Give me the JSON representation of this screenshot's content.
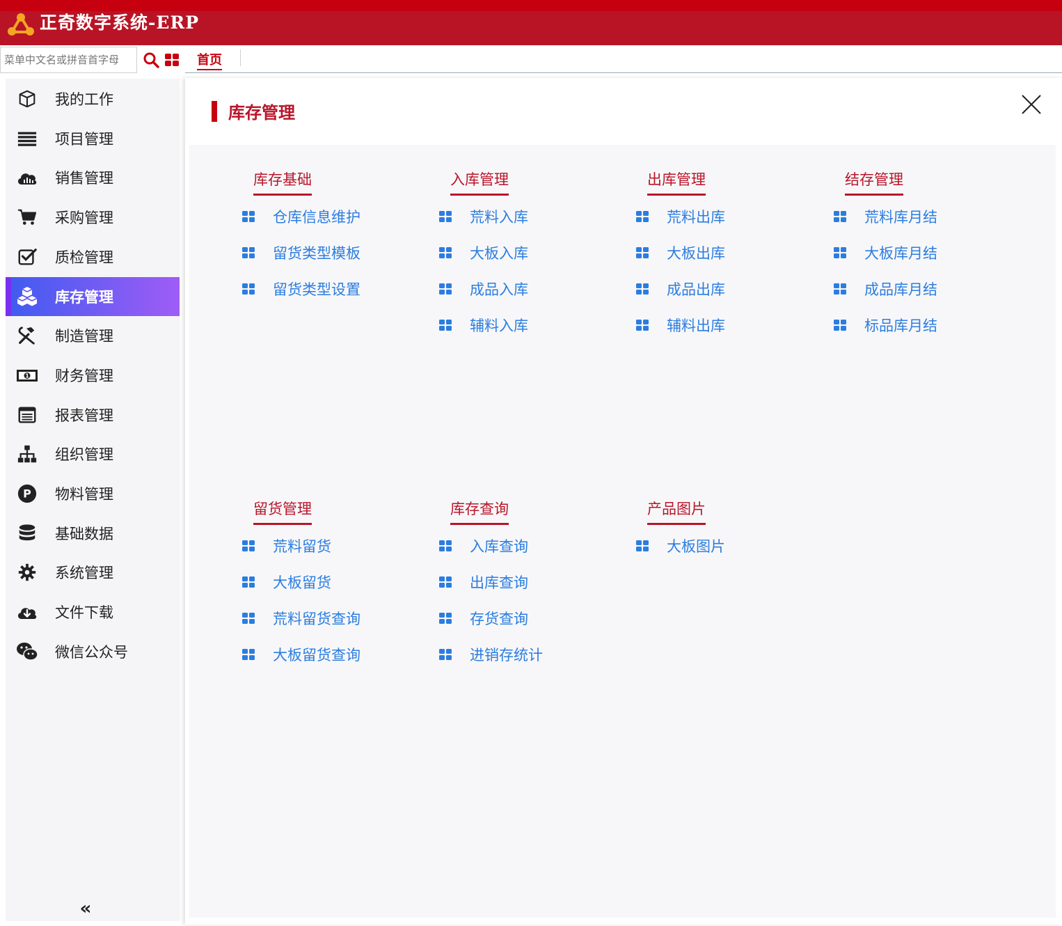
{
  "app": {
    "title": "正奇数字系统-ERP"
  },
  "toolbar": {
    "search_placeholder": "菜单中文名或拼音首字母",
    "home_tab": "首页"
  },
  "sidebar": {
    "items": [
      {
        "label": "我的工作",
        "icon": "cube-icon"
      },
      {
        "label": "项目管理",
        "icon": "list-icon"
      },
      {
        "label": "销售管理",
        "icon": "cloud-chart-icon"
      },
      {
        "label": "采购管理",
        "icon": "cart-icon"
      },
      {
        "label": "质检管理",
        "icon": "checkbox-icon"
      },
      {
        "label": "库存管理",
        "icon": "cubes-icon",
        "active": true
      },
      {
        "label": "制造管理",
        "icon": "tools-icon"
      },
      {
        "label": "财务管理",
        "icon": "money-icon"
      },
      {
        "label": "报表管理",
        "icon": "table-icon"
      },
      {
        "label": "组织管理",
        "icon": "sitemap-icon"
      },
      {
        "label": "物料管理",
        "icon": "p-circle-icon"
      },
      {
        "label": "基础数据",
        "icon": "database-icon"
      },
      {
        "label": "系统管理",
        "icon": "gear-icon"
      },
      {
        "label": "文件下载",
        "icon": "cloud-download-icon"
      },
      {
        "label": "微信公众号",
        "icon": "wechat-icon"
      }
    ],
    "collapse_label": "«"
  },
  "panel": {
    "title": "库存管理",
    "groups": [
      {
        "title": "库存基础",
        "links": [
          "仓库信息维护",
          "留货类型模板",
          "留货类型设置"
        ]
      },
      {
        "title": "入库管理",
        "links": [
          "荒料入库",
          "大板入库",
          "成品入库",
          "辅料入库"
        ]
      },
      {
        "title": "出库管理",
        "links": [
          "荒料出库",
          "大板出库",
          "成品出库",
          "辅料出库"
        ]
      },
      {
        "title": "结存管理",
        "links": [
          "荒料库月结",
          "大板库月结",
          "成品库月结",
          "标品库月结"
        ]
      },
      {
        "title": "留货管理",
        "links": [
          "荒料留货",
          "大板留货",
          "荒料留货查询",
          "大板留货查询"
        ]
      },
      {
        "title": "库存查询",
        "links": [
          "入库查询",
          "出库查询",
          "存货查询",
          "进销存统计"
        ]
      },
      {
        "title": "产品图片",
        "links": [
          "大板图片"
        ]
      }
    ]
  },
  "colors": {
    "brand_red": "#b91425",
    "active_gradient_start": "#3f5bf0",
    "active_gradient_end": "#9f5cf6",
    "link_blue": "#2b7de0"
  }
}
